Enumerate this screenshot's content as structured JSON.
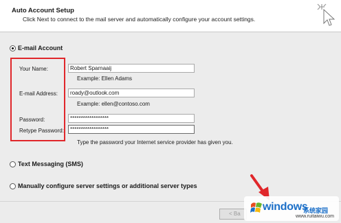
{
  "header": {
    "title": "Auto Account Setup",
    "subtitle": "Click Next to connect to the mail server and automatically configure your account settings."
  },
  "options": {
    "email_account": {
      "label": "E-mail Account",
      "selected": true
    },
    "text_messaging": {
      "label": "Text Messaging (SMS)",
      "selected": false
    },
    "manual": {
      "label": "Manually configure server settings or additional server types",
      "selected": false
    }
  },
  "form": {
    "your_name": {
      "label": "Your Name:",
      "value": "Robert Sparnaaij",
      "example": "Example: Ellen Adams"
    },
    "email": {
      "label": "E-mail Address:",
      "value": "roady@outlook.com",
      "example": "Example: ellen@contoso.com"
    },
    "password": {
      "label": "Password:",
      "value": "******************"
    },
    "retype_password": {
      "label": "Retype Password:",
      "value": "******************"
    },
    "password_hint": "Type the password your Internet service provider has given you."
  },
  "footer": {
    "back_label": "< Ba"
  },
  "watermark": {
    "brand": "windows",
    "cn": "系统家园",
    "url": "www.ruitaiwu.com"
  },
  "colors": {
    "highlight": "#e0262a",
    "watermark_blue": "#1b6fc8"
  }
}
